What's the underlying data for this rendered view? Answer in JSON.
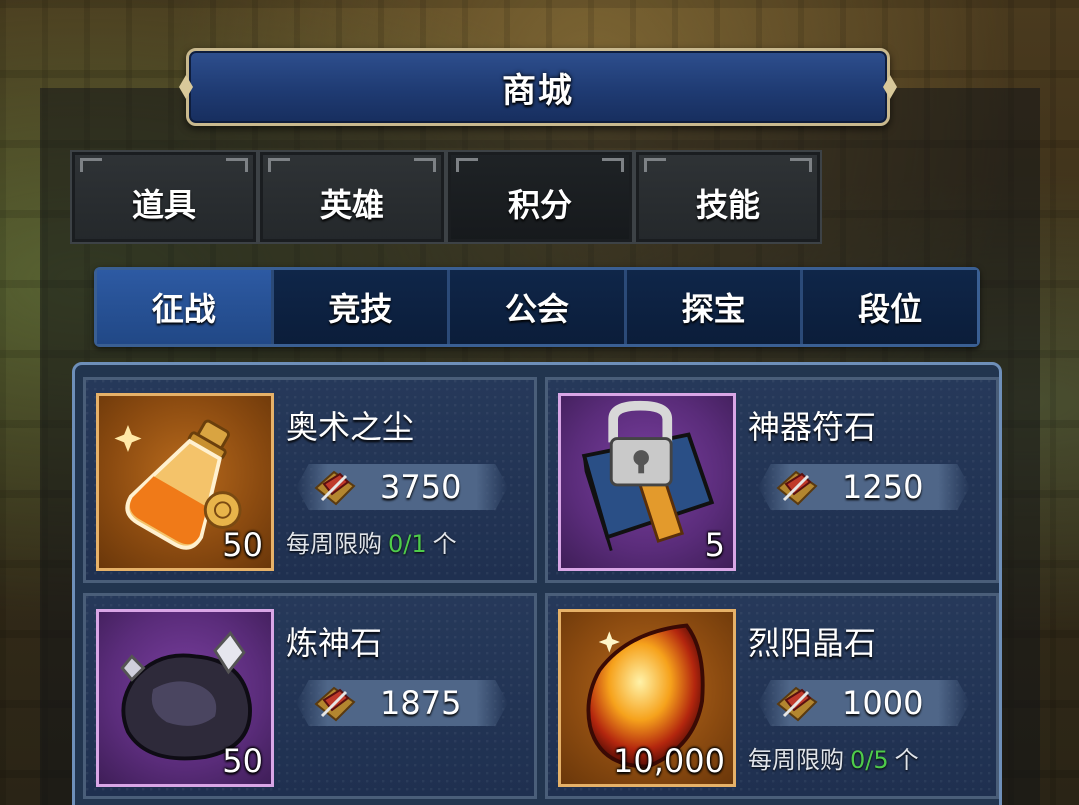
{
  "window": {
    "title": "商城"
  },
  "main_tabs": [
    {
      "label": "道具",
      "active": false
    },
    {
      "label": "英雄",
      "active": false
    },
    {
      "label": "积分",
      "active": true
    },
    {
      "label": "技能",
      "active": false
    }
  ],
  "sub_tabs": [
    {
      "label": "征战",
      "active": true
    },
    {
      "label": "竞技",
      "active": false
    },
    {
      "label": "公会",
      "active": false
    },
    {
      "label": "探宝",
      "active": false
    },
    {
      "label": "段位",
      "active": false
    }
  ],
  "items": [
    {
      "name": "奥术之尘",
      "quantity": "50",
      "price": "3750",
      "icon": "arcane-dust-potion-icon",
      "frame": "orange",
      "limit": {
        "prefix": "每周限购",
        "value": "0/1",
        "suffix": "个"
      }
    },
    {
      "name": "神器符石",
      "quantity": "5",
      "price": "1250",
      "icon": "artifact-runestone-book-icon",
      "frame": "purple"
    },
    {
      "name": "炼神石",
      "quantity": "50",
      "price": "1875",
      "icon": "refining-stone-icon",
      "frame": "purple"
    },
    {
      "name": "烈阳晶石",
      "quantity": "10,000",
      "price": "1000",
      "icon": "blazing-sun-crystal-icon",
      "frame": "orange",
      "limit": {
        "prefix": "每周限购",
        "value": "0/5",
        "suffix": "个"
      }
    }
  ],
  "currency_icon": "campaign-points-icon",
  "colors": {
    "title_bar": "#1f3b73",
    "active_subtab": "#2d5aa3",
    "limit_green": "#4ecb4a",
    "frame_orange": "#e6b168",
    "frame_purple": "#d9a6e6"
  }
}
